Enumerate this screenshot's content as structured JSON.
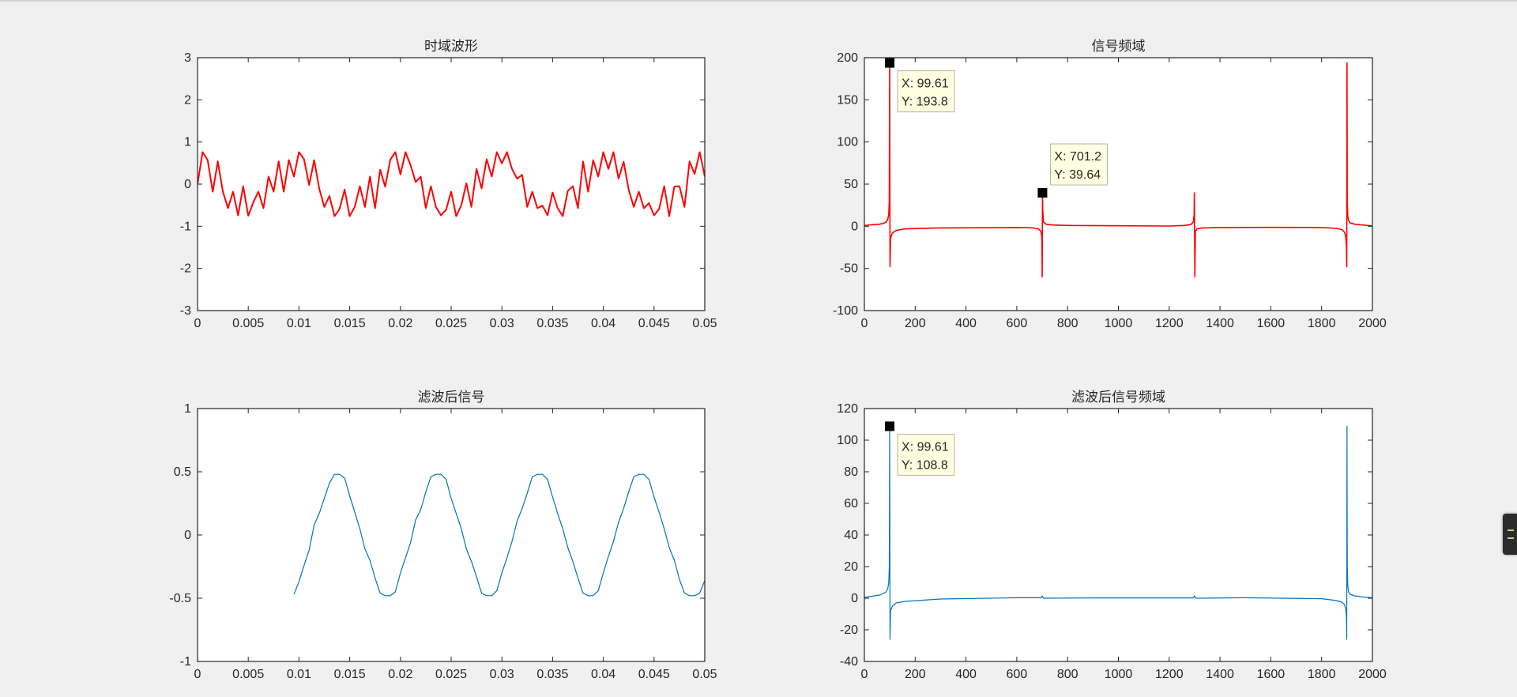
{
  "colors": {
    "background": "#f0f0f0",
    "axes_background": "#ffffff",
    "signal_red": "#ff0000",
    "signal_blue": "#0072bd",
    "datatip_background": "#ffffe1",
    "datatip_marker": "#000000"
  },
  "chart_data": [
    {
      "id": "time-waveform",
      "type": "line",
      "title": "时域波形",
      "xlabel": "",
      "ylabel": "",
      "xlim": [
        0,
        0.05
      ],
      "ylim": [
        -3,
        3
      ],
      "xticks": [
        0,
        0.005,
        0.01,
        0.015,
        0.02,
        0.025,
        0.03,
        0.035,
        0.04,
        0.045,
        0.05
      ],
      "xtick_labels": [
        "0",
        "0.005",
        "0.01",
        "0.015",
        "0.02",
        "0.025",
        "0.03",
        "0.035",
        "0.04",
        "0.045",
        "0.05"
      ],
      "yticks": [
        -3,
        -2,
        -1,
        0,
        1,
        2,
        3
      ],
      "ytick_labels": [
        "-3",
        "-2",
        "-1",
        "0",
        "1",
        "2",
        "3"
      ],
      "grid": false,
      "series": [
        {
          "color": "#ff0000",
          "line_width": 2,
          "x": [
            0,
            0.0005,
            0.001,
            0.0015,
            0.002,
            0.0025,
            0.003,
            0.0035,
            0.004,
            0.0045,
            0.005,
            0.0055,
            0.006,
            0.0065,
            0.007,
            0.0075,
            0.008,
            0.0085,
            0.009,
            0.0095,
            0.01,
            0.0105,
            0.011,
            0.0115,
            0.012,
            0.0125,
            0.013,
            0.0135,
            0.014,
            0.0145,
            0.015,
            0.0155,
            0.016,
            0.0165,
            0.017,
            0.0175,
            0.018,
            0.0185,
            0.019,
            0.0195,
            0.02,
            0.0205,
            0.021,
            0.0215,
            0.022,
            0.0225,
            0.023,
            0.0235,
            0.024,
            0.0245,
            0.025,
            0.0255,
            0.026,
            0.0265,
            0.027,
            0.0275,
            0.028,
            0.0285,
            0.029,
            0.0295,
            0.03,
            0.0305,
            0.031,
            0.0315,
            0.032,
            0.0325,
            0.033,
            0.0335,
            0.034,
            0.0345,
            0.035,
            0.0355,
            0.036,
            0.0365,
            0.037,
            0.0375,
            0.038,
            0.0385,
            0.039,
            0.0395,
            0.04,
            0.0405,
            0.041,
            0.0415,
            0.042,
            0.0425,
            0.043,
            0.0435,
            0.044,
            0.0445,
            0.045,
            0.0455,
            0.046,
            0.0465,
            0.047,
            0.0475,
            0.048,
            0.0485,
            0.049,
            0.0495,
            0.05
          ],
          "y": [
            0,
            0.76,
            0.57,
            -0.18,
            0.54,
            -0.18,
            -0.57,
            -0.18,
            -0.74,
            -0.05,
            -0.75,
            -0.43,
            -0.18,
            -0.57,
            0.18,
            -0.18,
            0.54,
            -0.18,
            0.57,
            0.18,
            0.76,
            0.59,
            -0.02,
            0.57,
            -0.11,
            -0.54,
            -0.28,
            -0.76,
            -0.59,
            -0.13,
            -0.76,
            -0.54,
            -0.05,
            -0.54,
            0.18,
            -0.57,
            0.34,
            -0.06,
            0.58,
            0.76,
            0.23,
            0.76,
            0.45,
            0.05,
            0.18,
            -0.57,
            -0.05,
            -0.54,
            -0.74,
            -0.61,
            -0.18,
            -0.76,
            -0.5,
            0.02,
            -0.54,
            0.36,
            -0.1,
            0.59,
            0.18,
            0.76,
            0.49,
            0.76,
            0.36,
            0.13,
            0.22,
            -0.54,
            -0.18,
            -0.57,
            -0.51,
            -0.74,
            -0.2,
            -0.57,
            -0.76,
            -0.16,
            -0.05,
            -0.57,
            0.54,
            -0.18,
            0.57,
            0.18,
            0.76,
            0.36,
            0.76,
            0.13,
            0.53,
            -0.13,
            -0.54,
            -0.18,
            -0.57,
            -0.45,
            -0.74,
            -0.59,
            -0.05,
            -0.76,
            -0.06,
            -0.05,
            -0.54,
            0.54,
            0.24,
            0.76,
            0.18
          ]
        }
      ]
    },
    {
      "id": "signal-spectrum",
      "type": "line",
      "title": "信号频域",
      "xlabel": "",
      "ylabel": "",
      "xlim": [
        0,
        2000
      ],
      "ylim": [
        -100,
        200
      ],
      "xticks": [
        0,
        200,
        400,
        600,
        800,
        1000,
        1200,
        1400,
        1600,
        1800,
        2000
      ],
      "xtick_labels": [
        "0",
        "200",
        "400",
        "600",
        "800",
        "1000",
        "1200",
        "1400",
        "1600",
        "1800",
        "2000"
      ],
      "yticks": [
        -100,
        -50,
        0,
        50,
        100,
        150,
        200
      ],
      "ytick_labels": [
        "-100",
        "-50",
        "0",
        "50",
        "100",
        "150",
        "200"
      ],
      "grid": false,
      "series": [
        {
          "color": "#ff0000",
          "line_width": 1.6,
          "x": [
            0,
            20,
            40,
            60,
            75,
            85,
            92,
            96,
            98,
            99.61,
            100,
            101,
            103,
            110,
            125,
            160,
            300,
            600,
            660,
            685,
            695,
            699,
            700,
            701.2,
            702,
            705,
            715,
            740,
            800,
            1000,
            1200,
            1260,
            1285,
            1295,
            1298,
            1299,
            1300,
            1301,
            1303,
            1310,
            1330,
            1400,
            1600,
            1800,
            1860,
            1880,
            1890,
            1895,
            1898,
            1899,
            1900,
            1901,
            1903,
            1906,
            1912,
            1930,
            1960,
            2000
          ],
          "y": [
            1,
            1.5,
            2,
            2.5,
            3.5,
            5,
            8,
            14,
            30,
            193.8,
            120,
            -48,
            -14,
            -8,
            -5,
            -3,
            -2,
            -1.5,
            -1.8,
            -3,
            -6,
            -14,
            -60,
            39.64,
            20,
            5,
            2.5,
            1.5,
            1,
            0.6,
            0.3,
            1,
            2,
            5,
            14,
            39.64,
            -14,
            -60,
            -6,
            -3,
            -2,
            -1.5,
            -1.3,
            -1.5,
            -2.5,
            -4,
            -7,
            -12,
            -25,
            -48,
            193.8,
            30,
            12,
            7,
            4,
            2.5,
            1.5,
            0.5
          ]
        }
      ],
      "datatips": [
        {
          "x": 99.61,
          "y": 193.8,
          "line1": "X: 99.61",
          "line2": "Y: 193.8",
          "anchor": "below-right"
        },
        {
          "x": 701.2,
          "y": 39.64,
          "line1": "X: 701.2",
          "line2": "Y: 39.64",
          "anchor": "above-right"
        }
      ]
    },
    {
      "id": "filtered-signal",
      "type": "line",
      "title": "滤波后信号",
      "xlabel": "",
      "ylabel": "",
      "xlim": [
        0,
        0.05
      ],
      "ylim": [
        -1,
        1
      ],
      "xticks": [
        0,
        0.005,
        0.01,
        0.015,
        0.02,
        0.025,
        0.03,
        0.035,
        0.04,
        0.045,
        0.05
      ],
      "xtick_labels": [
        "0",
        "0.005",
        "0.01",
        "0.015",
        "0.02",
        "0.025",
        "0.03",
        "0.035",
        "0.04",
        "0.045",
        "0.05"
      ],
      "yticks": [
        -1,
        -0.5,
        0,
        0.5,
        1
      ],
      "ytick_labels": [
        "-1",
        "-0.5",
        "0",
        "0.5",
        "1"
      ],
      "grid": false,
      "series": [
        {
          "color": "#0072bd",
          "line_width": 1.2,
          "x": [
            0.0095,
            0.01,
            0.0105,
            0.011,
            0.0115,
            0.012,
            0.0125,
            0.013,
            0.0135,
            0.014,
            0.0145,
            0.015,
            0.0155,
            0.016,
            0.0165,
            0.017,
            0.0175,
            0.018,
            0.0185,
            0.019,
            0.0195,
            0.02,
            0.0205,
            0.021,
            0.0215,
            0.022,
            0.0225,
            0.023,
            0.0235,
            0.024,
            0.0245,
            0.025,
            0.0255,
            0.026,
            0.0265,
            0.027,
            0.0275,
            0.028,
            0.0285,
            0.029,
            0.0295,
            0.03,
            0.0305,
            0.031,
            0.0315,
            0.032,
            0.0325,
            0.033,
            0.0335,
            0.034,
            0.0345,
            0.035,
            0.0355,
            0.036,
            0.0365,
            0.037,
            0.0375,
            0.038,
            0.0385,
            0.039,
            0.0395,
            0.04,
            0.0405,
            0.041,
            0.0415,
            0.042,
            0.0425,
            0.043,
            0.0435,
            0.044,
            0.0445,
            0.045,
            0.0455,
            0.046,
            0.0465,
            0.047,
            0.0475,
            0.048,
            0.0485,
            0.049,
            0.0495,
            0.05
          ],
          "y": [
            -0.47,
            -0.37,
            -0.24,
            -0.12,
            0.08,
            0.17,
            0.29,
            0.41,
            0.48,
            0.48,
            0.45,
            0.31,
            0.18,
            0.05,
            -0.11,
            -0.2,
            -0.34,
            -0.46,
            -0.48,
            -0.48,
            -0.45,
            -0.3,
            -0.18,
            -0.06,
            0.12,
            0.2,
            0.34,
            0.46,
            0.48,
            0.48,
            0.44,
            0.29,
            0.17,
            0.05,
            -0.11,
            -0.21,
            -0.33,
            -0.46,
            -0.48,
            -0.48,
            -0.44,
            -0.3,
            -0.18,
            -0.05,
            0.11,
            0.21,
            0.33,
            0.46,
            0.48,
            0.48,
            0.44,
            0.3,
            0.17,
            0.05,
            -0.1,
            -0.21,
            -0.34,
            -0.46,
            -0.48,
            -0.48,
            -0.44,
            -0.3,
            -0.17,
            -0.05,
            0.1,
            0.21,
            0.34,
            0.46,
            0.48,
            0.48,
            0.44,
            0.3,
            0.18,
            0.05,
            -0.1,
            -0.2,
            -0.35,
            -0.46,
            -0.48,
            -0.48,
            -0.46,
            -0.36
          ]
        }
      ]
    },
    {
      "id": "filtered-spectrum",
      "type": "line",
      "title": "滤波后信号频域",
      "xlabel": "",
      "ylabel": "",
      "xlim": [
        0,
        2000
      ],
      "ylim": [
        -40,
        120
      ],
      "xticks": [
        0,
        200,
        400,
        600,
        800,
        1000,
        1200,
        1400,
        1600,
        1800,
        2000
      ],
      "xtick_labels": [
        "0",
        "200",
        "400",
        "600",
        "800",
        "1000",
        "1200",
        "1400",
        "1600",
        "1800",
        "2000"
      ],
      "yticks": [
        -40,
        -20,
        0,
        20,
        40,
        60,
        80,
        100,
        120
      ],
      "ytick_labels": [
        "-40",
        "-20",
        "0",
        "20",
        "40",
        "60",
        "80",
        "100",
        "120"
      ],
      "grid": false,
      "series": [
        {
          "color": "#0072bd",
          "line_width": 1.2,
          "x": [
            0,
            20,
            40,
            60,
            75,
            85,
            92,
            96,
            98,
            99.61,
            100,
            101,
            103,
            110,
            125,
            160,
            300,
            600,
            695,
            700,
            705,
            900,
            1200,
            1295,
            1300,
            1305,
            1500,
            1800,
            1860,
            1880,
            1890,
            1895,
            1898,
            1899,
            1900,
            1901,
            1903,
            1906,
            1912,
            1930,
            1960,
            2000
          ],
          "y": [
            0.5,
            1,
            1.5,
            2,
            3,
            4,
            6,
            10,
            20,
            108.8,
            70,
            -26,
            -8,
            -5,
            -3,
            -2,
            -0.5,
            0.3,
            0.3,
            1.5,
            0,
            0.2,
            0.2,
            0.2,
            1.5,
            0,
            0.3,
            -0.3,
            -1.5,
            -2.5,
            -4,
            -7,
            -12,
            -26,
            108.8,
            20,
            8,
            4,
            2.5,
            1.5,
            0.8,
            0.3
          ]
        }
      ],
      "datatips": [
        {
          "x": 99.61,
          "y": 108.8,
          "line1": "X: 99.61",
          "line2": "Y: 108.8",
          "anchor": "below-right"
        }
      ]
    }
  ]
}
